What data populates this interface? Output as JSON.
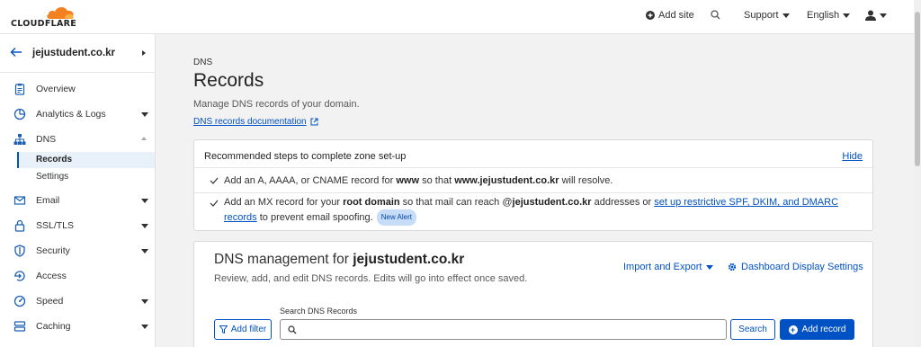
{
  "brand": {
    "name": "CLOUDFLARE",
    "accent": "#f48120",
    "link": "#0051c3"
  },
  "topbar": {
    "add_site": "Add site",
    "support": "Support",
    "language": "English"
  },
  "sidebar": {
    "zone": "jejustudent.co.kr",
    "items": [
      {
        "label": "Overview",
        "icon": "clipboard-icon"
      },
      {
        "label": "Analytics & Logs",
        "icon": "chart-icon"
      },
      {
        "label": "DNS",
        "icon": "network-icon"
      },
      {
        "label": "Email",
        "icon": "envelope-icon"
      },
      {
        "label": "SSL/TLS",
        "icon": "lock-icon"
      },
      {
        "label": "Security",
        "icon": "shield-icon"
      },
      {
        "label": "Access",
        "icon": "access-icon"
      },
      {
        "label": "Speed",
        "icon": "speed-icon"
      },
      {
        "label": "Caching",
        "icon": "caching-icon"
      }
    ],
    "dns_sub": [
      "Records",
      "Settings"
    ]
  },
  "main": {
    "breadcrumb": "DNS",
    "title": "Records",
    "subtitle": "Manage DNS records of your domain.",
    "doc_link": "DNS records documentation"
  },
  "steps": {
    "title": "Recommended steps to complete zone set-up",
    "hide": "Hide",
    "step1": {
      "a": "Add an A, AAAA, or CNAME record for ",
      "b": "www",
      "c": " so that ",
      "d": "www.jejustudent.co.kr",
      "e": " will resolve."
    },
    "step2": {
      "a": "Add an MX record for your ",
      "b": "root domain",
      "c": " so that mail can reach @",
      "d": "jejustudent.co.kr",
      "e": " addresses or ",
      "link": "set up restrictive SPF, DKIM, and DMARC records",
      "f": " to prevent email spoofing.",
      "badge": "New Alert"
    }
  },
  "dns": {
    "title_prefix": "DNS management for ",
    "title_zone": "jejustudent.co.kr",
    "description": "Review, add, and edit DNS records. Edits will go into effect once saved.",
    "import_export": "Import and Export",
    "display_settings": "Dashboard Display Settings",
    "add_filter": "Add filter",
    "search_label": "Search DNS Records",
    "search_value": "",
    "search_button": "Search",
    "add_record": "Add record"
  }
}
